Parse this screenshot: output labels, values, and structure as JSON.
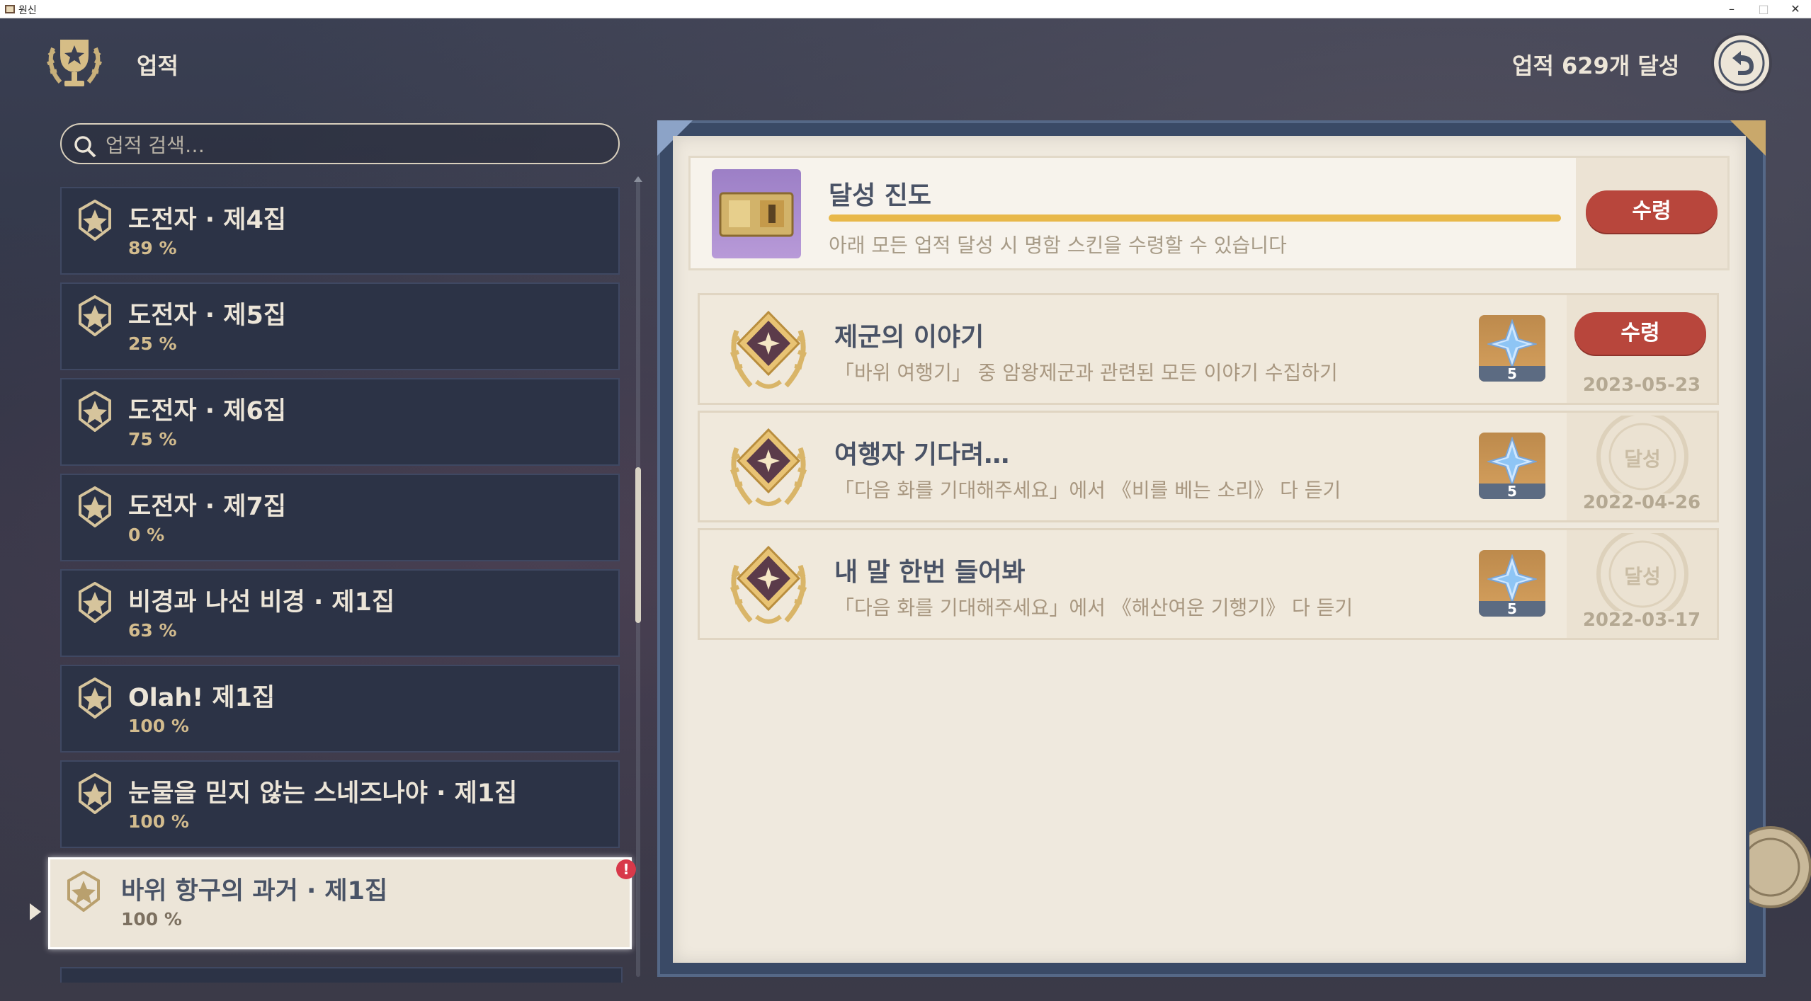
{
  "window": {
    "title": "원신"
  },
  "header": {
    "title": "업적",
    "achievement_count": "업적 629개 달성"
  },
  "search": {
    "placeholder": "업적 검색…"
  },
  "categories": [
    {
      "name": "도전자 · 제4집",
      "progress": "89 %"
    },
    {
      "name": "도전자 · 제5집",
      "progress": "25 %"
    },
    {
      "name": "도전자 · 제6집",
      "progress": "75 %"
    },
    {
      "name": "도전자 · 제7집",
      "progress": "0 %"
    },
    {
      "name": "비경과 나선 비경 · 제1집",
      "progress": "63 %"
    },
    {
      "name": "Olah! 제1집",
      "progress": "100 %"
    },
    {
      "name": "눈물을 믿지 않는 스네즈나야 · 제1집",
      "progress": "100 %"
    },
    {
      "name": "바위 항구의 과거 · 제1집",
      "progress": "100 %",
      "selected": true,
      "alert": "!"
    }
  ],
  "progress_card": {
    "title": "달성 진도",
    "percent": "100 %",
    "fill": 1.0,
    "description": "아래 모든 업적 달성 시 명함 스킨을 수령할 수 있습니다",
    "claim_label": "수령"
  },
  "achievements": [
    {
      "title": "제군의 이야기",
      "description": "「바위 여행기」 중 암왕제군과 관련된 모든 이야기 수집하기",
      "reward_qty": "5",
      "status": "claim",
      "claim_label": "수령",
      "date": "2023-05-23"
    },
    {
      "title": "여행자 기다려…",
      "description": "「다음 화를 기대해주세요」에서 《비를 베는 소리》 다 듣기",
      "reward_qty": "5",
      "status": "done",
      "stamp_label": "달성",
      "date": "2022-04-26"
    },
    {
      "title": "내 말 한번 들어봐",
      "description": "「다음 화를 기대해주세요」에서 《해산여운 기행기》 다 듣기",
      "reward_qty": "5",
      "status": "done",
      "stamp_label": "달성",
      "date": "2022-03-17"
    }
  ],
  "icons": {
    "app": "genshin-app-icon",
    "trophy": "trophy-icon",
    "back": "back-arrow-icon",
    "search": "search-icon",
    "category": "achievement-category-icon",
    "reward": "primogem-icon",
    "medal": "achievement-medal-icon"
  },
  "colors": {
    "accent_gold": "#d3bc8e",
    "claim_red": "#b8463c",
    "progress_fill": "#e8b84a",
    "page_bg": "#efe9de",
    "alert": "#d8394a"
  }
}
